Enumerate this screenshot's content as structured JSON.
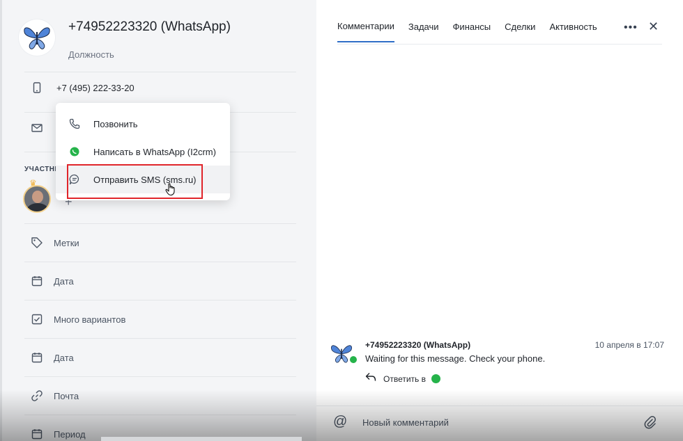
{
  "contact": {
    "title": "+74952223320 (WhatsApp)",
    "position_label": "Должность",
    "phone": "+7 (495) 222-33-20"
  },
  "participants_label": "УЧАСТНИ",
  "fields": [
    {
      "icon": "tag-icon",
      "label": "Метки"
    },
    {
      "icon": "calendar-icon",
      "label": "Дата"
    },
    {
      "icon": "checkbox-icon",
      "label": "Много вариантов"
    },
    {
      "icon": "calendar-icon",
      "label": "Дата"
    },
    {
      "icon": "link-icon",
      "label": "Почта"
    },
    {
      "icon": "calendar-icon",
      "label": "Период"
    }
  ],
  "dropdown": {
    "items": [
      {
        "label": "Позвонить",
        "icon": "phone-icon"
      },
      {
        "label": "Написать в WhatsApp (I2crm)",
        "icon": "whatsapp-icon"
      },
      {
        "label": "Отправить SMS (sms.ru)",
        "icon": "sms-icon"
      }
    ]
  },
  "tabs": [
    "Комментарии",
    "Задачи",
    "Финансы",
    "Сделки",
    "Активность"
  ],
  "message": {
    "author": "+74952223320 (WhatsApp)",
    "time": "10 апреля в 17:07",
    "text": "Waiting for this message. Check your phone.",
    "reply_label": "Ответить в"
  },
  "composer": {
    "placeholder": "Новый комментарий"
  },
  "colors": {
    "accent": "#2f6ec7",
    "whatsapp": "#25b34a",
    "highlight": "#e0242a"
  }
}
